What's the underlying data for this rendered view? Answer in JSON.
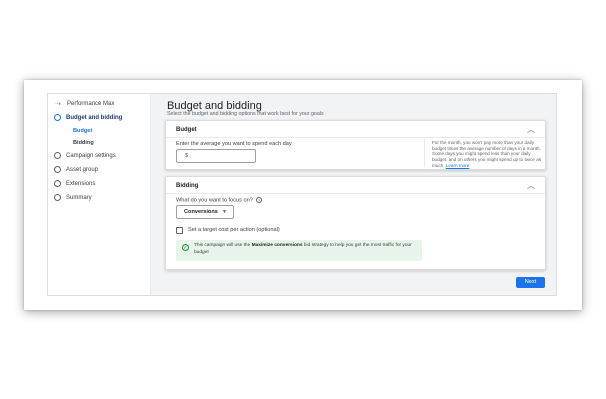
{
  "sidebar": {
    "header": "Performance Max",
    "items": [
      {
        "label": "Budget and bidding"
      },
      {
        "label": "Campaign settings"
      },
      {
        "label": "Asset group"
      },
      {
        "label": "Extensions"
      },
      {
        "label": "Summary"
      }
    ],
    "sub_items": [
      {
        "label": "Budget"
      },
      {
        "label": "Bidding"
      }
    ]
  },
  "main": {
    "title": "Budget and bidding",
    "subtitle": "Select the budget and bidding options that work best for your goals",
    "budget_card": {
      "title": "Budget",
      "input_label": "Enter the average you want to spend each day",
      "input_value": "$",
      "help_text": "For the month, you won't pay more than your daily budget times the average number of days in a month. Some days you might spend less than your daily budget, and on others you might spend up to twice as much.",
      "learn_more": "Learn more"
    },
    "bidding_card": {
      "title": "Bidding",
      "question": "What do you want to focus on?",
      "select_value": "Conversions",
      "checkbox_label": "Set a target cost per action (optional)",
      "info_prefix": "This campaign will use the ",
      "info_bold": "Maximize conversions",
      "info_suffix": " bid strategy to help you get the most traffic for your budget"
    },
    "next_label": "Next"
  },
  "colors": {
    "accent": "#1a73e8",
    "success_bg": "#e6f4ea",
    "success": "#1e8e3e"
  }
}
